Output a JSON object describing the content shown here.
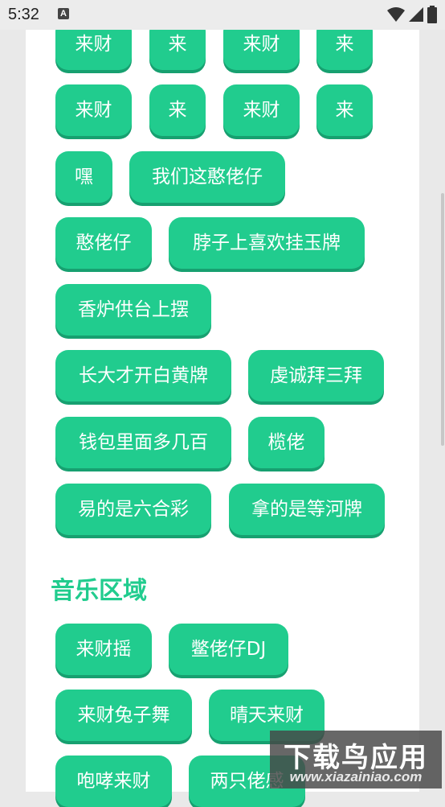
{
  "status_bar": {
    "time": "5:32",
    "notification_badge": "A"
  },
  "tags_top": [
    "来财",
    "来",
    "来财",
    "来",
    "来财",
    "来",
    "来财",
    "来",
    "嘿",
    "我们这憨佬仔",
    "憨佬仔",
    "脖子上喜欢挂玉牌",
    "香炉供台上摆",
    "长大才开白黄牌",
    "虔诚拜三拜",
    "钱包里面多几百",
    "榄佬",
    "易的是六合彩",
    "拿的是等河牌"
  ],
  "music_section": {
    "title": "音乐区域",
    "tags": [
      "来财摇",
      "鳖佬仔DJ",
      "来财兔子舞",
      "晴天来财",
      "咆哮来财",
      "两只佬感"
    ]
  },
  "watermark": {
    "title": "下载鸟应用",
    "url": "www.xiazainiao.com"
  },
  "colors": {
    "accent": "#21cc8e",
    "accent_shadow": "#17a070",
    "card_bg": "#ffffff",
    "page_bg": "#e9e9e9"
  }
}
